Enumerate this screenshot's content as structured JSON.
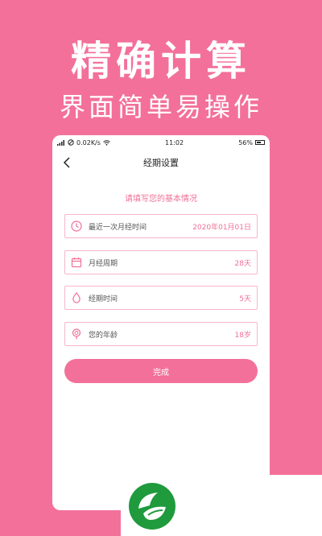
{
  "hero": {
    "title": "精确计算",
    "subtitle": "界面简单易操作"
  },
  "statusbar": {
    "network": "0.02K/s",
    "time": "11:02",
    "battery": "56%"
  },
  "navbar": {
    "title": "经期设置"
  },
  "prompt": "请填写您的基本情况",
  "fields": [
    {
      "label": "最近一次月经时间",
      "value": "2020年01月01日",
      "icon": "clock-icon"
    },
    {
      "label": "月经周期",
      "value": "28天",
      "icon": "calendar-icon"
    },
    {
      "label": "经期时间",
      "value": "5天",
      "icon": "droplet-icon"
    },
    {
      "label": "您的年龄",
      "value": "18岁",
      "icon": "lollipop-icon"
    }
  ],
  "done_label": "完成",
  "colors": {
    "brand": "#f3709b",
    "field_border": "#f5b6c9",
    "accent_text": "#f06f97"
  }
}
